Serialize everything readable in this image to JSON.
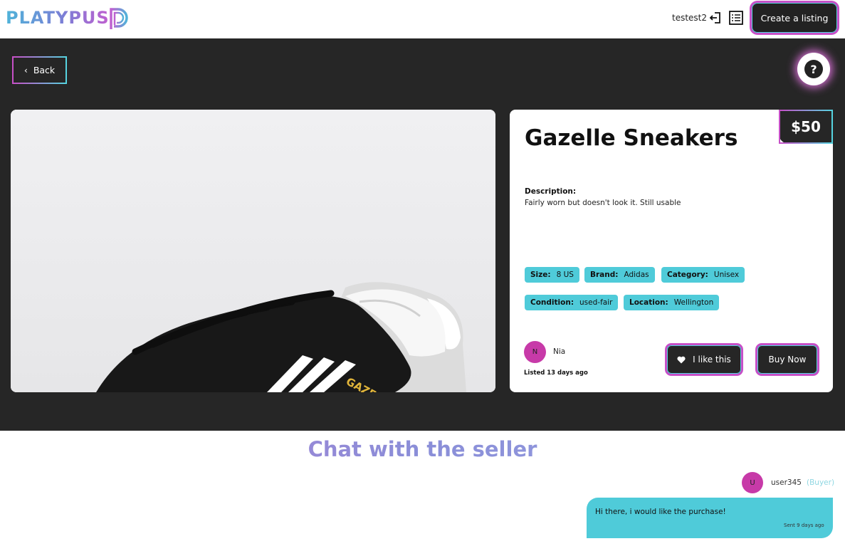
{
  "header": {
    "logo_text": "PLATYPUS",
    "username": "testest2",
    "logout_icon": "logout-icon",
    "listings_icon": "list-icon",
    "create_label": "Create a listing"
  },
  "nav": {
    "back_label": "Back",
    "help_label": "?"
  },
  "listing": {
    "price": "$50",
    "title": "Gazelle Sneakers",
    "description_label": "Description:",
    "description": "Fairly worn but doesn't look it. Still usable",
    "attributes": [
      {
        "label": "Size:",
        "value": "8 US"
      },
      {
        "label": "Brand:",
        "value": "Adidas"
      },
      {
        "label": "Category:",
        "value": "Unisex"
      },
      {
        "label": "Condition:",
        "value": "used-fair"
      },
      {
        "label": "Location:",
        "value": "Wellington"
      }
    ],
    "seller": {
      "initial": "N",
      "name": "Nia"
    },
    "listed": "Listed 13 days ago",
    "like_label": "I like this",
    "buy_label": "Buy Now",
    "image_text": "GAZEL"
  },
  "chat": {
    "title": "Chat with the seller",
    "messages": [
      {
        "initial": "U",
        "user": "user345",
        "role": "(Buyer)",
        "text": "Hi there, i would like the purchase!",
        "time": "Sent 9 days ago"
      }
    ]
  },
  "colors": {
    "accent_pink": "#c74fc7",
    "accent_cyan": "#55d4e0",
    "chip_bg": "#4fcbd9",
    "dark_bg": "#262626"
  }
}
